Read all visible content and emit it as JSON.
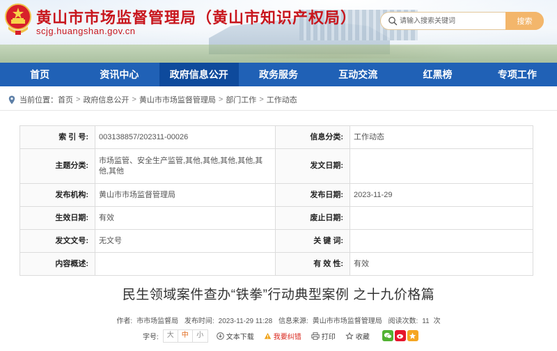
{
  "header": {
    "title": "黄山市市场监督管理局（黄山市知识产权局）",
    "domain": "scjg.huangshan.gov.cn",
    "search_placeholder": "请输入搜索关键词",
    "search_button": "搜索"
  },
  "nav": {
    "items": [
      {
        "label": "首页"
      },
      {
        "label": "资讯中心"
      },
      {
        "label": "政府信息公开"
      },
      {
        "label": "政务服务"
      },
      {
        "label": "互动交流"
      },
      {
        "label": "红黑榜"
      },
      {
        "label": "专项工作"
      }
    ],
    "active_index": 2
  },
  "breadcrumb": {
    "prefix": "当前位置：",
    "items": [
      "首页",
      "政府信息公开",
      "黄山市市场监督管理局",
      "部门工作",
      "工作动态"
    ],
    "separator": ">"
  },
  "info": {
    "index_label": "索 引 号:",
    "index_value": "003138857/202311-00026",
    "category_label": "信息分类:",
    "category_value": "工作动态",
    "topic_label": "主题分类:",
    "topic_value": "市场监管、安全生产监管,其他,其他,其他,其他,其他,其他",
    "doc_date_label": "发文日期:",
    "doc_date_value": "",
    "publisher_label": "发布机构:",
    "publisher_value": "黄山市市场监督管理局",
    "pub_date_label": "发布日期:",
    "pub_date_value": "2023-11-29",
    "effective_label": "生效日期:",
    "effective_value": "有效",
    "abolish_label": "废止日期:",
    "abolish_value": "",
    "doc_no_label": "发文文号:",
    "doc_no_value": "无文号",
    "keywords_label": "关 键 词:",
    "keywords_value": "",
    "summary_label": "内容概述:",
    "summary_value": "",
    "validity_label": "有 效 性:",
    "validity_value": "有效"
  },
  "article": {
    "title": "民生领域案件查办“铁拳”行动典型案例  之十九价格篇",
    "author_label": "作者:",
    "author": "市市场监督局",
    "time_label": "发布时间:",
    "time": "2023-11-29 11:28",
    "source_label": "信息来源:",
    "source": "黄山市市场监督管理局",
    "views_label": "阅读次数:",
    "views": "11",
    "views_unit": "次"
  },
  "tools": {
    "font_label": "字号:",
    "sizes": [
      "大",
      "中",
      "小"
    ],
    "active_size": "中",
    "download": "文本下载",
    "correction": "我要纠错",
    "print": "打印",
    "favorite": "收藏"
  },
  "colors": {
    "brand_red": "#c8161d",
    "nav_blue": "#2061b6",
    "nav_active": "#0e4a9c",
    "search_button": "#f3b66b"
  }
}
